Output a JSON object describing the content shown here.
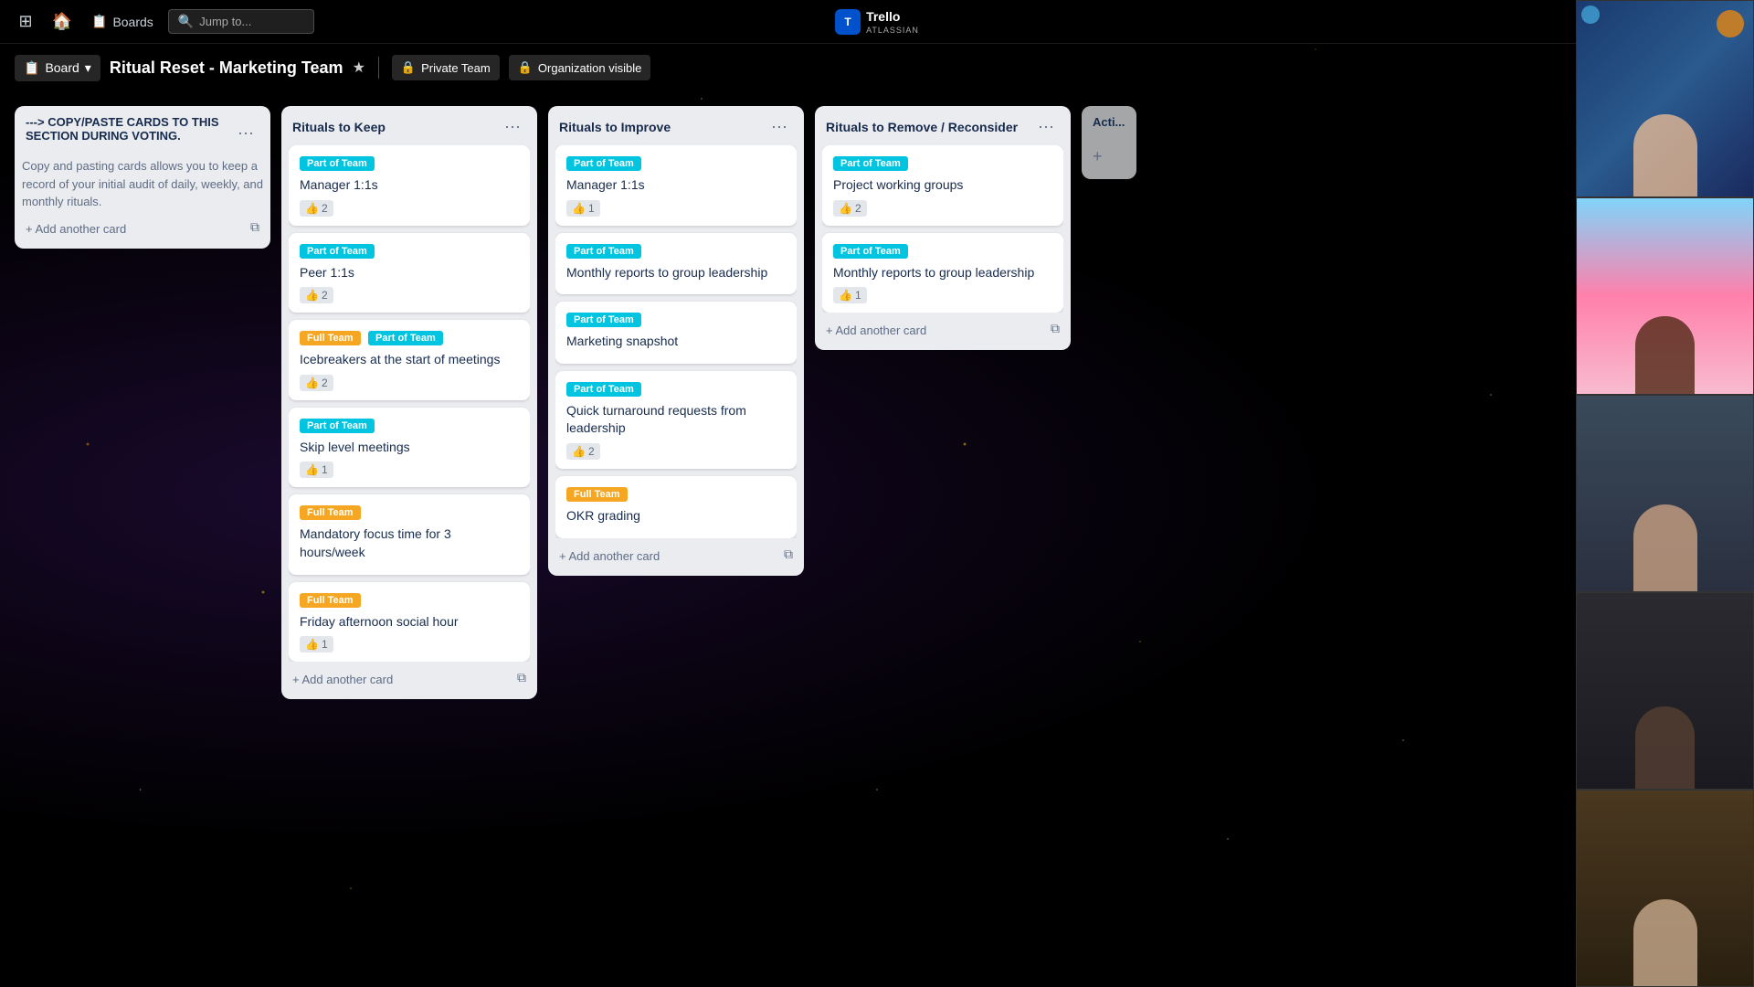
{
  "app": {
    "name": "Trello",
    "sub": "ATLASSIAN"
  },
  "nav": {
    "grid_icon": "⊞",
    "home_icon": "🏠",
    "boards_icon": "📋",
    "boards_label": "Boards",
    "search_placeholder": "Jump to...",
    "search_icon": "🔍",
    "add_icon": "+",
    "info_icon": "ℹ",
    "bell_icon": "🔔"
  },
  "board_header": {
    "board_label": "Board",
    "board_chevron": "▾",
    "title": "Ritual Reset - Marketing Team",
    "star_icon": "★",
    "private_label": "Private Team",
    "org_icon": "🔒",
    "org_label": "Organization visible"
  },
  "columns": [
    {
      "id": "copy-paste",
      "title": "---> COPY/PASTE CARDS TO THIS SECTION DURING VOTING.",
      "description": "Copy and pasting cards allows you to keep a record of your initial audit of daily, weekly, and monthly rituals.",
      "menu_icon": "···",
      "add_card_label": "+ Add another card",
      "copy_icon": "⧉",
      "cards": []
    },
    {
      "id": "rituals-to-keep",
      "title": "Rituals to Keep",
      "menu_icon": "···",
      "add_card_label": "+ Add another card",
      "copy_icon": "⧉",
      "cards": [
        {
          "id": "rk1",
          "tags": [
            {
              "label": "Part of Team",
              "type": "cyan"
            }
          ],
          "title": "Manager 1:1s",
          "likes": 2
        },
        {
          "id": "rk2",
          "tags": [
            {
              "label": "Part of Team",
              "type": "cyan"
            }
          ],
          "title": "Peer 1:1s",
          "likes": 2
        },
        {
          "id": "rk3",
          "tags": [
            {
              "label": "Full Team",
              "type": "orange"
            },
            {
              "label": "Part of Team",
              "type": "cyan"
            }
          ],
          "title": "Icebreakers at the start of meetings",
          "likes": 2
        },
        {
          "id": "rk4",
          "tags": [
            {
              "label": "Part of Team",
              "type": "cyan"
            }
          ],
          "title": "Skip level meetings",
          "likes": 1
        },
        {
          "id": "rk5",
          "tags": [
            {
              "label": "Full Team",
              "type": "orange"
            }
          ],
          "title": "Mandatory focus time for 3 hours/week",
          "likes": null
        },
        {
          "id": "rk6",
          "tags": [
            {
              "label": "Full Team",
              "type": "orange"
            }
          ],
          "title": "Friday afternoon social hour",
          "likes": 1
        }
      ]
    },
    {
      "id": "rituals-to-improve",
      "title": "Rituals to Improve",
      "menu_icon": "···",
      "add_card_label": "+ Add another card",
      "copy_icon": "⧉",
      "cards": [
        {
          "id": "ri1",
          "tags": [
            {
              "label": "Part of Team",
              "type": "cyan"
            }
          ],
          "title": "Manager 1:1s",
          "likes": 1
        },
        {
          "id": "ri2",
          "tags": [
            {
              "label": "Part of Team",
              "type": "cyan"
            }
          ],
          "title": "Monthly reports to group leadership",
          "likes": null
        },
        {
          "id": "ri3",
          "tags": [
            {
              "label": "Part of Team",
              "type": "cyan"
            }
          ],
          "title": "Marketing snapshot",
          "likes": null
        },
        {
          "id": "ri4",
          "tags": [
            {
              "label": "Part of Team",
              "type": "cyan"
            }
          ],
          "title": "Quick turnaround requests from leadership",
          "likes": 2
        },
        {
          "id": "ri5",
          "tags": [
            {
              "label": "Full Team",
              "type": "orange"
            }
          ],
          "title": "OKR grading",
          "likes": null
        }
      ]
    },
    {
      "id": "rituals-to-remove",
      "title": "Rituals to Remove / Reconsider",
      "menu_icon": "···",
      "add_card_label": "+ Add another card",
      "copy_icon": "⧉",
      "cards": [
        {
          "id": "rr1",
          "tags": [
            {
              "label": "Part of Team",
              "type": "cyan"
            }
          ],
          "title": "Project working groups",
          "likes": 2
        },
        {
          "id": "rr2",
          "tags": [
            {
              "label": "Part of Team",
              "type": "cyan"
            }
          ],
          "title": "Monthly reports to group leadership",
          "likes": 1
        }
      ]
    },
    {
      "id": "action",
      "title": "Acti...",
      "menu_icon": "···",
      "add_icon": "+",
      "cards": []
    }
  ],
  "video_panels": [
    {
      "id": "v1",
      "person_class": "person-1"
    },
    {
      "id": "v2",
      "person_class": "person-2"
    },
    {
      "id": "v3",
      "person_class": "person-3"
    },
    {
      "id": "v4",
      "person_class": "person-4"
    },
    {
      "id": "v5",
      "person_class": "person-5"
    }
  ]
}
